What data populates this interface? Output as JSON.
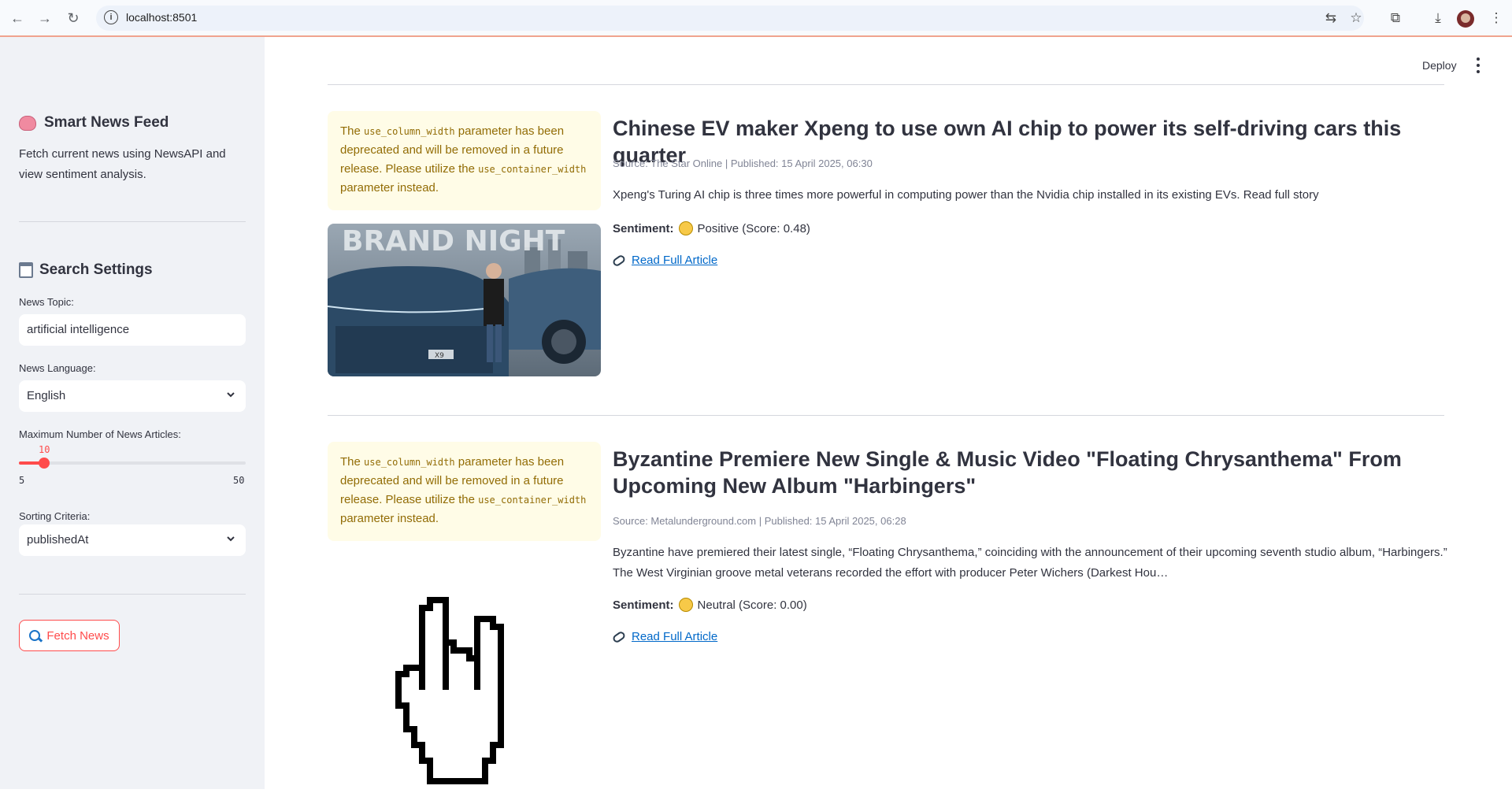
{
  "browser": {
    "url": "localhost:8501"
  },
  "sidebar": {
    "title": "Smart News Feed",
    "description": "Fetch current news using NewsAPI and view sentiment analysis.",
    "settings_title": "Search Settings",
    "topic_label": "News Topic:",
    "topic_value": "artificial intelligence",
    "language_label": "News Language:",
    "language_value": "English",
    "max_label": "Maximum Number of News Articles:",
    "max_value": 10,
    "max_min": 5,
    "max_max": 50,
    "sort_label": "Sorting Criteria:",
    "sort_value": "publishedAt",
    "fetch_label": "Fetch News"
  },
  "header": {
    "deploy": "Deploy"
  },
  "warning": {
    "pre": "The ",
    "code1": "use_column_width",
    "mid": " parameter has been deprecated and will be removed in a future release. Please utilize the ",
    "code2": "use_container_width",
    "post": " parameter instead."
  },
  "articles": [
    {
      "title": "Chinese EV maker Xpeng to use own AI chip to power its self-driving cars this quarter",
      "meta": "Source: The Star Online | Published: 15 April 2025, 06:30",
      "description": "Xpeng's Turing AI chip is three times more powerful in computing power than the Nvidia chip installed in its existing EVs. Read full story",
      "sentiment_label": "Sentiment:",
      "sentiment": "Positive (Score: 0.48)",
      "link": "Read Full Article",
      "image_text": "BRAND NIGHT",
      "plate": "X9"
    },
    {
      "title": "Byzantine Premiere New Single & Music Video \"Floating Chrysanthema\" From Upcoming New Album \"Harbingers\"",
      "meta": "Source: Metalunderground.com | Published: 15 April 2025, 06:28",
      "description": "Byzantine have premiered their latest single, “Floating Chrysanthema,” coinciding with the announcement of their upcoming seventh studio album, “Harbingers.” The West Virginian groove metal veterans recorded the effort with producer Peter Wichers (Darkest Hou…",
      "sentiment_label": "Sentiment:",
      "sentiment": "Neutral (Score: 0.00)",
      "link": "Read Full Article"
    }
  ]
}
